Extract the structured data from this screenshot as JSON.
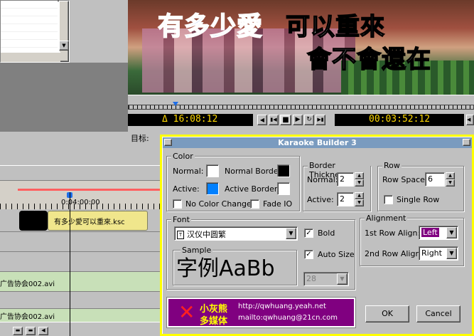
{
  "video": {
    "line1": "有多少愛",
    "line2": "可以重來",
    "line3": "會不會還在"
  },
  "timeline": {
    "current_time": "16:08:12",
    "current_prefix": "Δ",
    "duration": "00:03:52:12",
    "target_label": "目标:",
    "ruler_time": "0:04:00:00",
    "clip_ksc": "有多少愛可以重來.ksc",
    "clip_avi_1": "广告协会002.avi",
    "clip_avi_2": "广告协会002.avi"
  },
  "dialog": {
    "title": "Karaoke Builder 3",
    "color_group": "Color",
    "normal_label": "Normal:",
    "normal_border_label": "Normal Border:",
    "active_label": "Active:",
    "active_border_label": "Active Border:",
    "no_color_change": "No Color Change",
    "fade_io": "Fade IO",
    "border_group": "Border Thickness",
    "border_normal_label": "Normal:",
    "border_normal_value": "2",
    "border_active_label": "Active:",
    "border_active_value": "2",
    "row_group": "Row",
    "row_space_label": "Row Space:",
    "row_space_value": "6",
    "single_row": "Single Row",
    "font_group": "Font",
    "font_name": "汉仪中圆繁",
    "bold": "Bold",
    "auto_size": "Auto Size",
    "font_size": "28",
    "sample_group": "Sample",
    "sample_text": "字例AaBb",
    "alignment_group": "Alignment",
    "row1_align_label": "1st Row Align:",
    "row1_align_value": "Left",
    "row2_align_label": "2nd Row Align:",
    "row2_align_value": "Right",
    "logo_line1": "小灰熊",
    "logo_line2": "多媒体",
    "url": "http://qwhuang.yeah.net",
    "mailto": "mailto:qwhuang@21cn.com",
    "ok": "OK",
    "cancel": "Cancel"
  },
  "colors": {
    "normal_swatch": "#ffffff",
    "normal_border_swatch": "#000000",
    "active_swatch": "#0080ff",
    "active_border_swatch": "#ffffff",
    "title_bar": "#7a9bbf",
    "dialog_frame": "#ffff00",
    "logo_bg": "#800080",
    "clip_ksc_bg": "#f0e68c",
    "clip_avi_bg": "#c8e0b8",
    "selected_align_bg": "#800080"
  },
  "state": {
    "no_color_change_checked": false,
    "fade_io_checked": false,
    "single_row_checked": false,
    "bold_checked": true,
    "auto_size_checked": true
  }
}
